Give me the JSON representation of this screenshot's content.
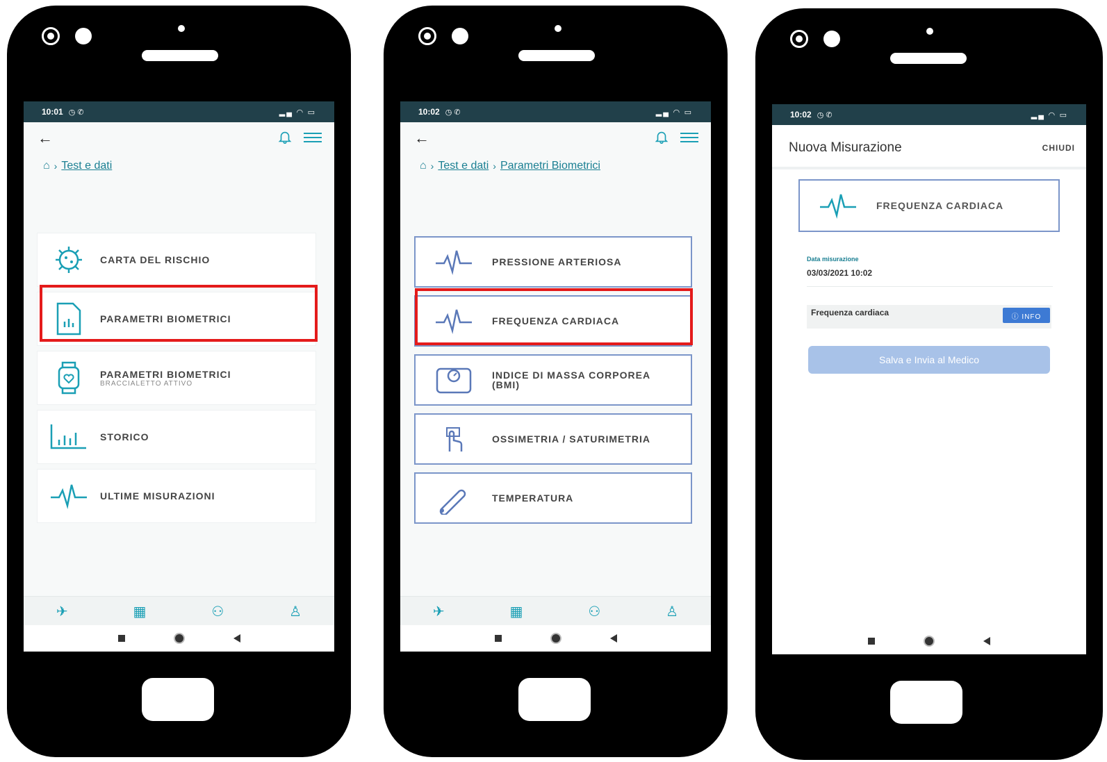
{
  "phone1": {
    "status": {
      "time": "10:01",
      "icons": "◷ ✆"
    },
    "breadcrumb": {
      "items": [
        "Test e dati"
      ]
    },
    "menu": [
      {
        "label": "CARTA DEL RISCHIO",
        "icon": "virus-icon"
      },
      {
        "label": "PARAMETRI BIOMETRICI",
        "icon": "document-chart-icon"
      },
      {
        "label": "PARAMETRI BIOMETRICI",
        "sub": "BRACCIALETTO ATTIVO",
        "icon": "smartwatch-icon"
      },
      {
        "label": "STORICO",
        "icon": "bar-chart-icon"
      },
      {
        "label": "ULTIME MISURAZIONI",
        "icon": "heartbeat-icon"
      }
    ]
  },
  "phone2": {
    "status": {
      "time": "10:02",
      "icons": "◷ ✆"
    },
    "breadcrumb": {
      "items": [
        "Test e dati",
        "Parametri Biometrici"
      ]
    },
    "menu": [
      {
        "label": "PRESSIONE ARTERIOSA",
        "icon": "heartbeat-icon"
      },
      {
        "label": "FREQUENZA CARDIACA",
        "icon": "heartbeat-icon"
      },
      {
        "label": "INDICE DI MASSA CORPOREA",
        "label2": "(BMI)",
        "icon": "scale-icon"
      },
      {
        "label": "OSSIMETRIA / SATURIMETRIA",
        "icon": "finger-icon"
      },
      {
        "label": "TEMPERATURA",
        "icon": "thermometer-icon"
      }
    ]
  },
  "phone3": {
    "status": {
      "time": "10:02",
      "icons": "◷ ✆"
    },
    "header": {
      "title": "Nuova Misurazione",
      "close_label": "CHIUDI"
    },
    "selected": {
      "label": "FREQUENZA CARDIACA",
      "icon": "heartbeat-icon"
    },
    "date_label": "Data misurazione",
    "date_value": "03/03/2021 10:02",
    "field_label": "Frequenza cardiaca",
    "info_label": "ⓘ INFO",
    "save_label": "Salva e Invia al Medico"
  },
  "colors": {
    "teal": "#1a9fb5",
    "blue_border": "#7b95c9",
    "highlight": "#e41b1b",
    "status_bar": "#21404a"
  }
}
